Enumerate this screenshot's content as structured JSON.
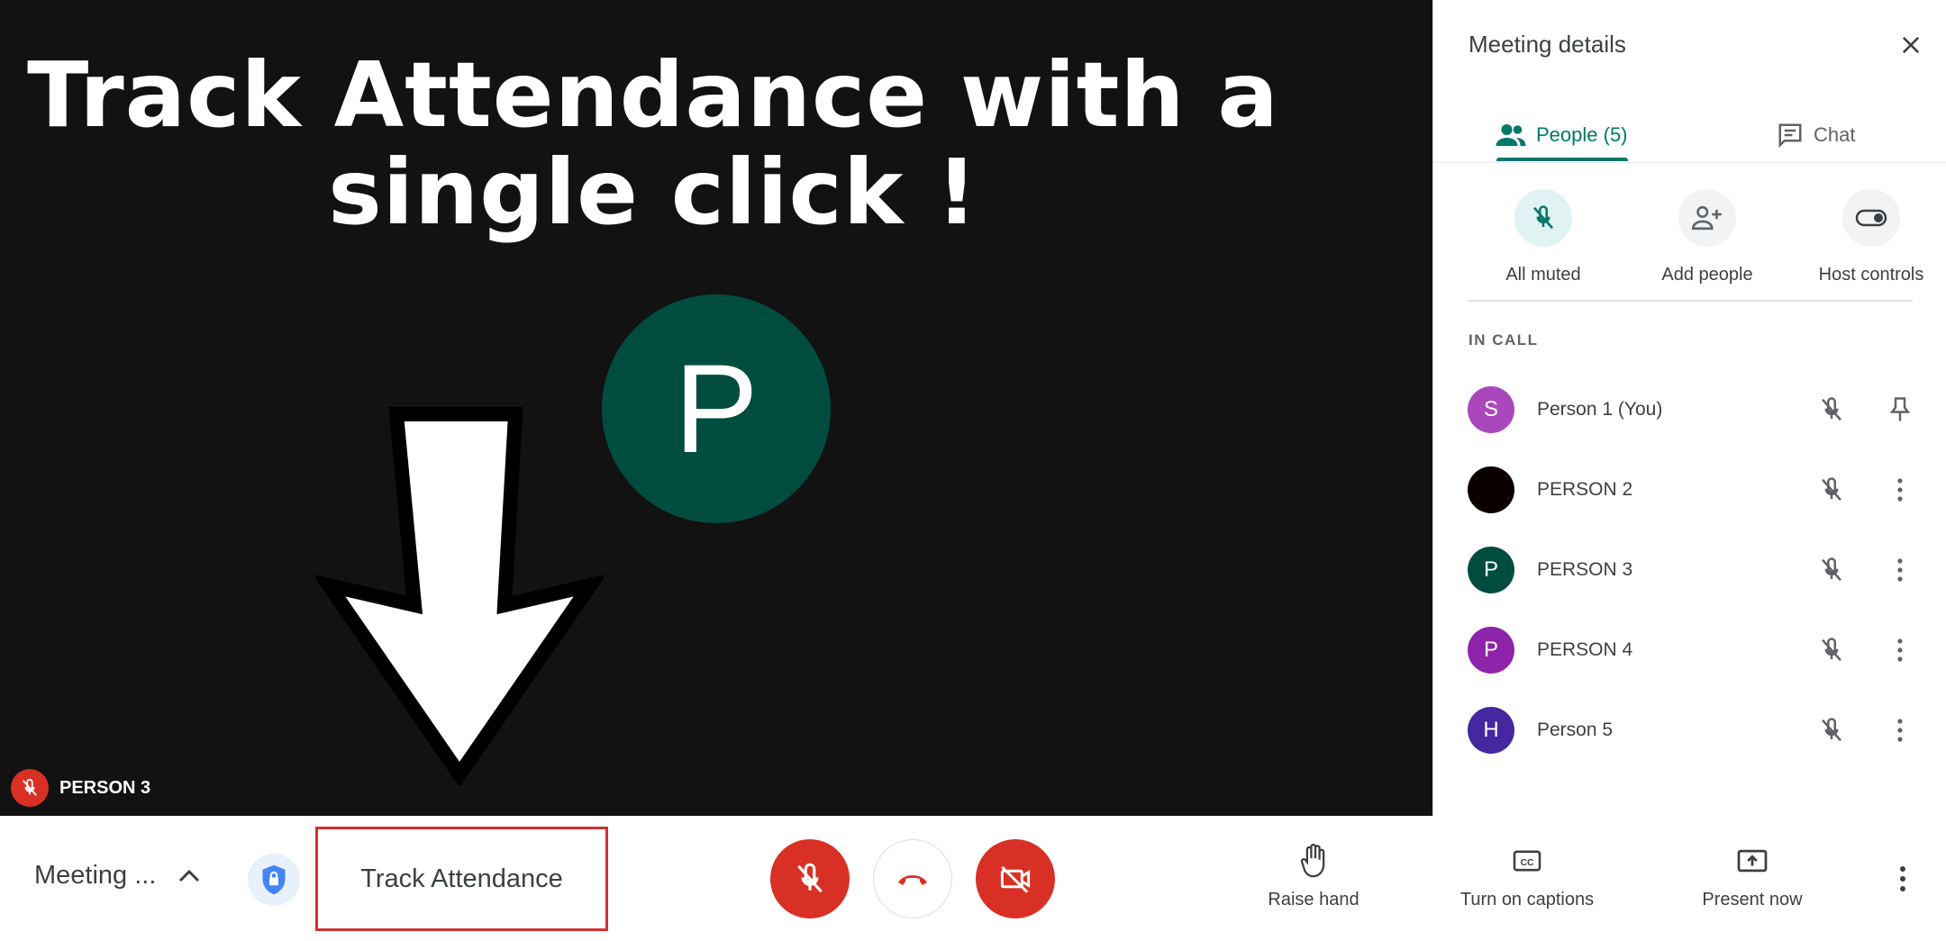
{
  "headline": {
    "line1": "Track Attendance with a",
    "line2": "single click !"
  },
  "stage": {
    "avatar_letter": "P",
    "tile_name": "PERSON 3"
  },
  "panel": {
    "title": "Meeting details",
    "tabs": [
      {
        "label": "People (5)",
        "icon": "people-icon"
      },
      {
        "label": "Chat",
        "icon": "chat-icon"
      }
    ],
    "actions": [
      {
        "label": "All muted",
        "icon": "mic-off-icon"
      },
      {
        "label": "Add people",
        "icon": "add-person-icon"
      },
      {
        "label": "Host controls",
        "icon": "toggle-icon"
      }
    ],
    "section_label": "IN CALL",
    "people": [
      {
        "initial": "S",
        "name": "Person 1 (You)",
        "color": "#ab47bc",
        "trailing": "pin-icon"
      },
      {
        "initial": "",
        "name": "PERSON 2",
        "color": "#0a0000",
        "trailing": "more-vert-icon"
      },
      {
        "initial": "P",
        "name": "PERSON 3",
        "color": "#004d40",
        "trailing": "more-vert-icon"
      },
      {
        "initial": "P",
        "name": "PERSON 4",
        "color": "#8e24aa",
        "trailing": "more-vert-icon"
      },
      {
        "initial": "H",
        "name": "Person 5",
        "color": "#4527a0",
        "trailing": "more-vert-icon"
      }
    ]
  },
  "bar": {
    "meeting_details": "Meeting ...",
    "track_attendance": "Track Attendance",
    "raise_hand": "Raise hand",
    "captions": "Turn on captions",
    "present": "Present now"
  },
  "colors": {
    "accent": "#00796b",
    "danger": "#d93025",
    "highlight_border": "#d32f2f",
    "stage_bg": "#121212"
  }
}
